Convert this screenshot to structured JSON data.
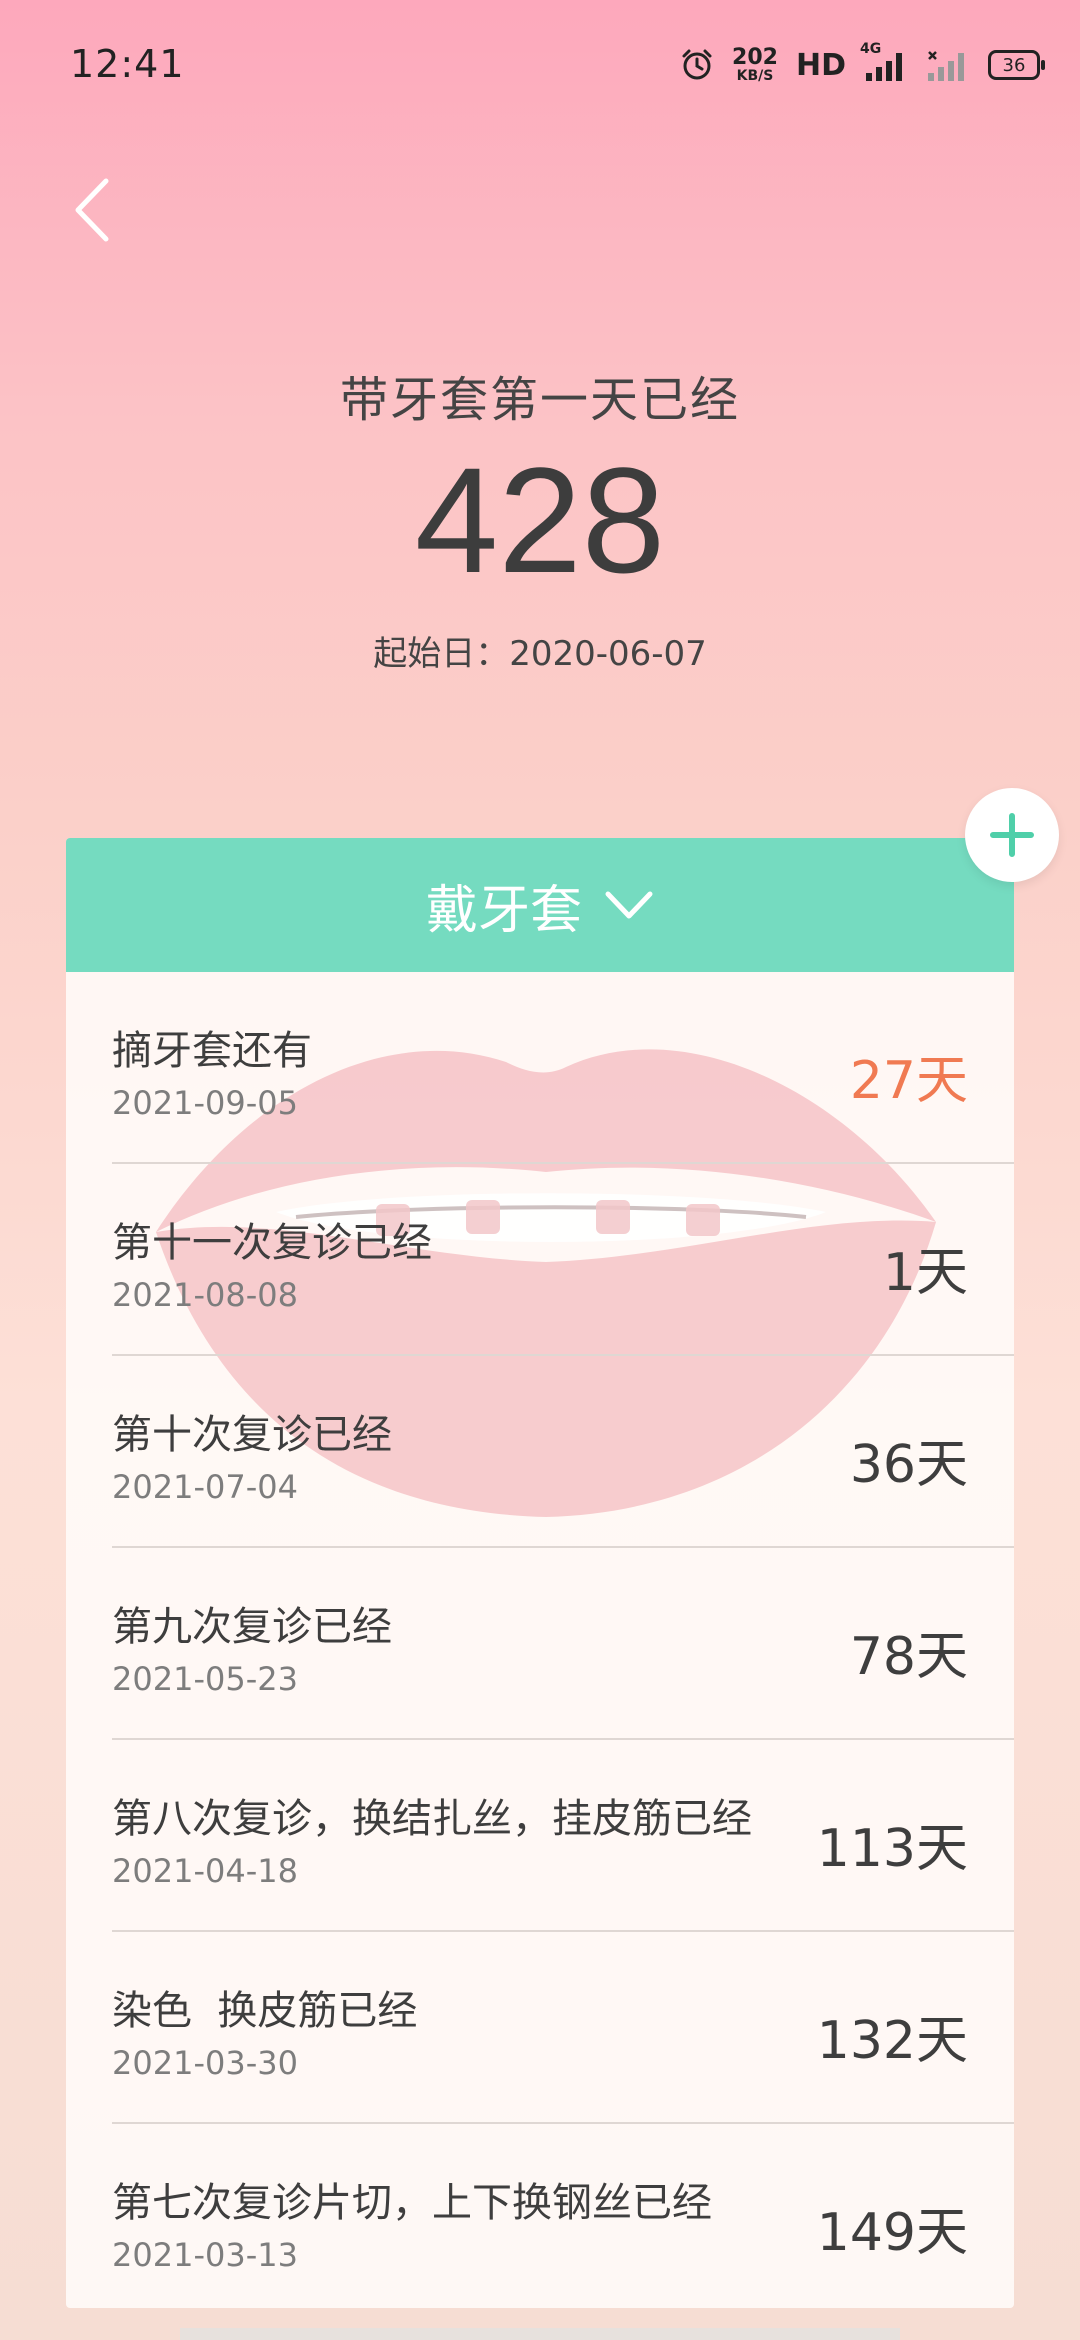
{
  "status_bar": {
    "time": "12:41",
    "speed_value": "202",
    "speed_unit": "KB/S",
    "hd_label": "HD",
    "network_label": "4G",
    "battery": "36"
  },
  "header": {
    "title": "带牙套第一天已经",
    "count": "428",
    "start_date": "起始日：2020-06-07"
  },
  "card": {
    "tab_label": "戴牙套",
    "items": [
      {
        "title": "摘牙套还有",
        "date": "2021-09-05",
        "value": "27天",
        "highlight": true
      },
      {
        "title": "第十一次复诊已经",
        "date": "2021-08-08",
        "value": "1天",
        "highlight": false
      },
      {
        "title": "第十次复诊已经",
        "date": "2021-07-04",
        "value": "36天",
        "highlight": false
      },
      {
        "title": "第九次复诊已经",
        "date": "2021-05-23",
        "value": "78天",
        "highlight": false
      },
      {
        "title": "第八次复诊，换结扎丝，挂皮筋已经",
        "date": "2021-04-18",
        "value": "113天",
        "highlight": false
      },
      {
        "title": "染色  换皮筋已经",
        "date": "2021-03-30",
        "value": "132天",
        "highlight": false
      },
      {
        "title": "第七次复诊片切，上下换钢丝已经",
        "date": "2021-03-13",
        "value": "149天",
        "highlight": false
      }
    ]
  },
  "colors": {
    "accent": "#75dbc0",
    "highlight": "#f07a52",
    "background_top": "#fda8bc",
    "background_bottom": "#f6ddd3"
  },
  "icons": {
    "back": "chevron-left-icon",
    "add": "plus-icon",
    "dropdown": "chevron-down-icon",
    "alarm": "alarm-icon",
    "signal": "signal-icon",
    "battery": "battery-icon",
    "illustration": "lips-braces-illustration"
  }
}
